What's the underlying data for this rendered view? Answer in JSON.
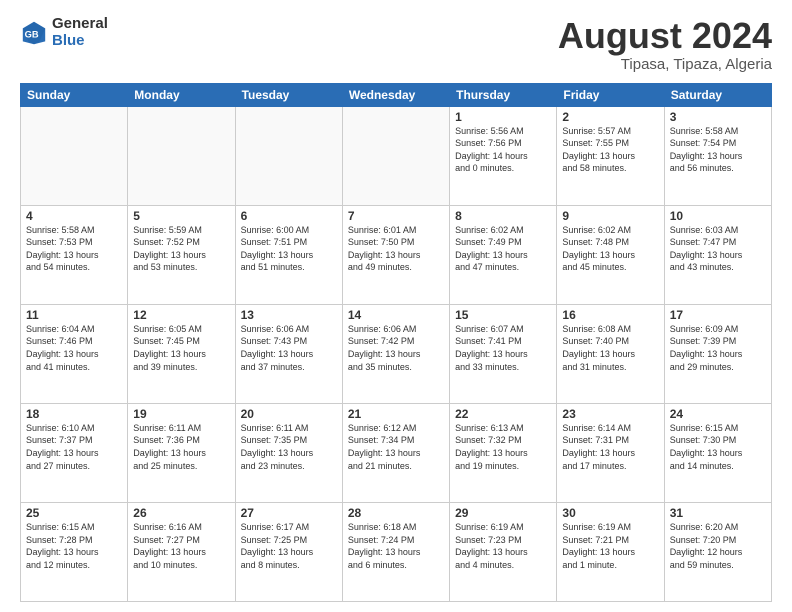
{
  "logo": {
    "general": "General",
    "blue": "Blue"
  },
  "header": {
    "title": "August 2024",
    "subtitle": "Tipasa, Tipaza, Algeria"
  },
  "weekdays": [
    "Sunday",
    "Monday",
    "Tuesday",
    "Wednesday",
    "Thursday",
    "Friday",
    "Saturday"
  ],
  "weeks": [
    [
      {
        "day": "",
        "info": ""
      },
      {
        "day": "",
        "info": ""
      },
      {
        "day": "",
        "info": ""
      },
      {
        "day": "",
        "info": ""
      },
      {
        "day": "1",
        "info": "Sunrise: 5:56 AM\nSunset: 7:56 PM\nDaylight: 14 hours\nand 0 minutes."
      },
      {
        "day": "2",
        "info": "Sunrise: 5:57 AM\nSunset: 7:55 PM\nDaylight: 13 hours\nand 58 minutes."
      },
      {
        "day": "3",
        "info": "Sunrise: 5:58 AM\nSunset: 7:54 PM\nDaylight: 13 hours\nand 56 minutes."
      }
    ],
    [
      {
        "day": "4",
        "info": "Sunrise: 5:58 AM\nSunset: 7:53 PM\nDaylight: 13 hours\nand 54 minutes."
      },
      {
        "day": "5",
        "info": "Sunrise: 5:59 AM\nSunset: 7:52 PM\nDaylight: 13 hours\nand 53 minutes."
      },
      {
        "day": "6",
        "info": "Sunrise: 6:00 AM\nSunset: 7:51 PM\nDaylight: 13 hours\nand 51 minutes."
      },
      {
        "day": "7",
        "info": "Sunrise: 6:01 AM\nSunset: 7:50 PM\nDaylight: 13 hours\nand 49 minutes."
      },
      {
        "day": "8",
        "info": "Sunrise: 6:02 AM\nSunset: 7:49 PM\nDaylight: 13 hours\nand 47 minutes."
      },
      {
        "day": "9",
        "info": "Sunrise: 6:02 AM\nSunset: 7:48 PM\nDaylight: 13 hours\nand 45 minutes."
      },
      {
        "day": "10",
        "info": "Sunrise: 6:03 AM\nSunset: 7:47 PM\nDaylight: 13 hours\nand 43 minutes."
      }
    ],
    [
      {
        "day": "11",
        "info": "Sunrise: 6:04 AM\nSunset: 7:46 PM\nDaylight: 13 hours\nand 41 minutes."
      },
      {
        "day": "12",
        "info": "Sunrise: 6:05 AM\nSunset: 7:45 PM\nDaylight: 13 hours\nand 39 minutes."
      },
      {
        "day": "13",
        "info": "Sunrise: 6:06 AM\nSunset: 7:43 PM\nDaylight: 13 hours\nand 37 minutes."
      },
      {
        "day": "14",
        "info": "Sunrise: 6:06 AM\nSunset: 7:42 PM\nDaylight: 13 hours\nand 35 minutes."
      },
      {
        "day": "15",
        "info": "Sunrise: 6:07 AM\nSunset: 7:41 PM\nDaylight: 13 hours\nand 33 minutes."
      },
      {
        "day": "16",
        "info": "Sunrise: 6:08 AM\nSunset: 7:40 PM\nDaylight: 13 hours\nand 31 minutes."
      },
      {
        "day": "17",
        "info": "Sunrise: 6:09 AM\nSunset: 7:39 PM\nDaylight: 13 hours\nand 29 minutes."
      }
    ],
    [
      {
        "day": "18",
        "info": "Sunrise: 6:10 AM\nSunset: 7:37 PM\nDaylight: 13 hours\nand 27 minutes."
      },
      {
        "day": "19",
        "info": "Sunrise: 6:11 AM\nSunset: 7:36 PM\nDaylight: 13 hours\nand 25 minutes."
      },
      {
        "day": "20",
        "info": "Sunrise: 6:11 AM\nSunset: 7:35 PM\nDaylight: 13 hours\nand 23 minutes."
      },
      {
        "day": "21",
        "info": "Sunrise: 6:12 AM\nSunset: 7:34 PM\nDaylight: 13 hours\nand 21 minutes."
      },
      {
        "day": "22",
        "info": "Sunrise: 6:13 AM\nSunset: 7:32 PM\nDaylight: 13 hours\nand 19 minutes."
      },
      {
        "day": "23",
        "info": "Sunrise: 6:14 AM\nSunset: 7:31 PM\nDaylight: 13 hours\nand 17 minutes."
      },
      {
        "day": "24",
        "info": "Sunrise: 6:15 AM\nSunset: 7:30 PM\nDaylight: 13 hours\nand 14 minutes."
      }
    ],
    [
      {
        "day": "25",
        "info": "Sunrise: 6:15 AM\nSunset: 7:28 PM\nDaylight: 13 hours\nand 12 minutes."
      },
      {
        "day": "26",
        "info": "Sunrise: 6:16 AM\nSunset: 7:27 PM\nDaylight: 13 hours\nand 10 minutes."
      },
      {
        "day": "27",
        "info": "Sunrise: 6:17 AM\nSunset: 7:25 PM\nDaylight: 13 hours\nand 8 minutes."
      },
      {
        "day": "28",
        "info": "Sunrise: 6:18 AM\nSunset: 7:24 PM\nDaylight: 13 hours\nand 6 minutes."
      },
      {
        "day": "29",
        "info": "Sunrise: 6:19 AM\nSunset: 7:23 PM\nDaylight: 13 hours\nand 4 minutes."
      },
      {
        "day": "30",
        "info": "Sunrise: 6:19 AM\nSunset: 7:21 PM\nDaylight: 13 hours\nand 1 minute."
      },
      {
        "day": "31",
        "info": "Sunrise: 6:20 AM\nSunset: 7:20 PM\nDaylight: 12 hours\nand 59 minutes."
      }
    ]
  ]
}
